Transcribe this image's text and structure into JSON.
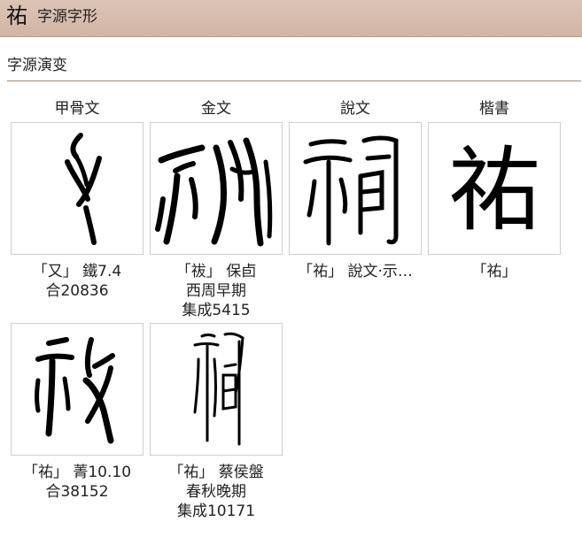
{
  "header": {
    "char": "祐",
    "title": "字源字形"
  },
  "section": {
    "title": "字源演变"
  },
  "columns": [
    "甲骨文",
    "金文",
    "說文",
    "楷書"
  ],
  "items": [
    {
      "lines": [
        "「又」 鐵7.4",
        "合20836"
      ]
    },
    {
      "lines": [
        "「祓」 保卣",
        "西周早期",
        "集成5415"
      ]
    },
    {
      "lines": [
        "「祐」 說文·示…"
      ]
    },
    {
      "lines": [
        "「祐」"
      ],
      "glyph": "祐"
    },
    {
      "lines": [
        "「祐」 菁10.10",
        "合38152"
      ]
    },
    {
      "lines": [
        "「祐」 蔡侯盤",
        "春秋晚期",
        "集成10171"
      ]
    }
  ]
}
